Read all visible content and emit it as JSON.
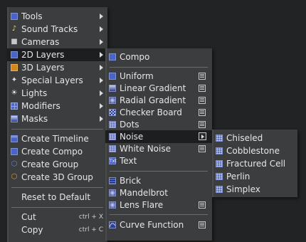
{
  "menu1": {
    "items": [
      {
        "label": "Tools"
      },
      {
        "label": "Sound Tracks"
      },
      {
        "label": "Cameras"
      },
      {
        "label": "2D Layers"
      },
      {
        "label": "3D Layers"
      },
      {
        "label": "Special Layers"
      },
      {
        "label": "Lights"
      },
      {
        "label": "Modifiers"
      },
      {
        "label": "Masks"
      },
      {
        "label": "Create Timeline"
      },
      {
        "label": "Create Compo"
      },
      {
        "label": "Create Group"
      },
      {
        "label": "Create 3D Group"
      },
      {
        "label": "Reset to Default"
      },
      {
        "label": "Cut",
        "shortcut": "ctrl + X"
      },
      {
        "label": "Copy",
        "shortcut": "ctrl + C"
      }
    ]
  },
  "menu2": {
    "items": [
      {
        "label": "Compo"
      },
      {
        "label": "Uniform"
      },
      {
        "label": "Linear Gradient"
      },
      {
        "label": "Radial Gradient"
      },
      {
        "label": "Checker Board"
      },
      {
        "label": "Dots"
      },
      {
        "label": "Noise"
      },
      {
        "label": "White Noise"
      },
      {
        "label": "Text"
      },
      {
        "label": "Brick"
      },
      {
        "label": "Mandelbrot"
      },
      {
        "label": "Lens Flare"
      },
      {
        "label": "Curve Function"
      }
    ]
  },
  "menu3": {
    "items": [
      {
        "label": "Chiseled"
      },
      {
        "label": "Cobblestone"
      },
      {
        "label": "Fractured Cell"
      },
      {
        "label": "Perlin"
      },
      {
        "label": "Simplex"
      }
    ]
  },
  "icons": {
    "text_icon_glyph": "Txt"
  }
}
